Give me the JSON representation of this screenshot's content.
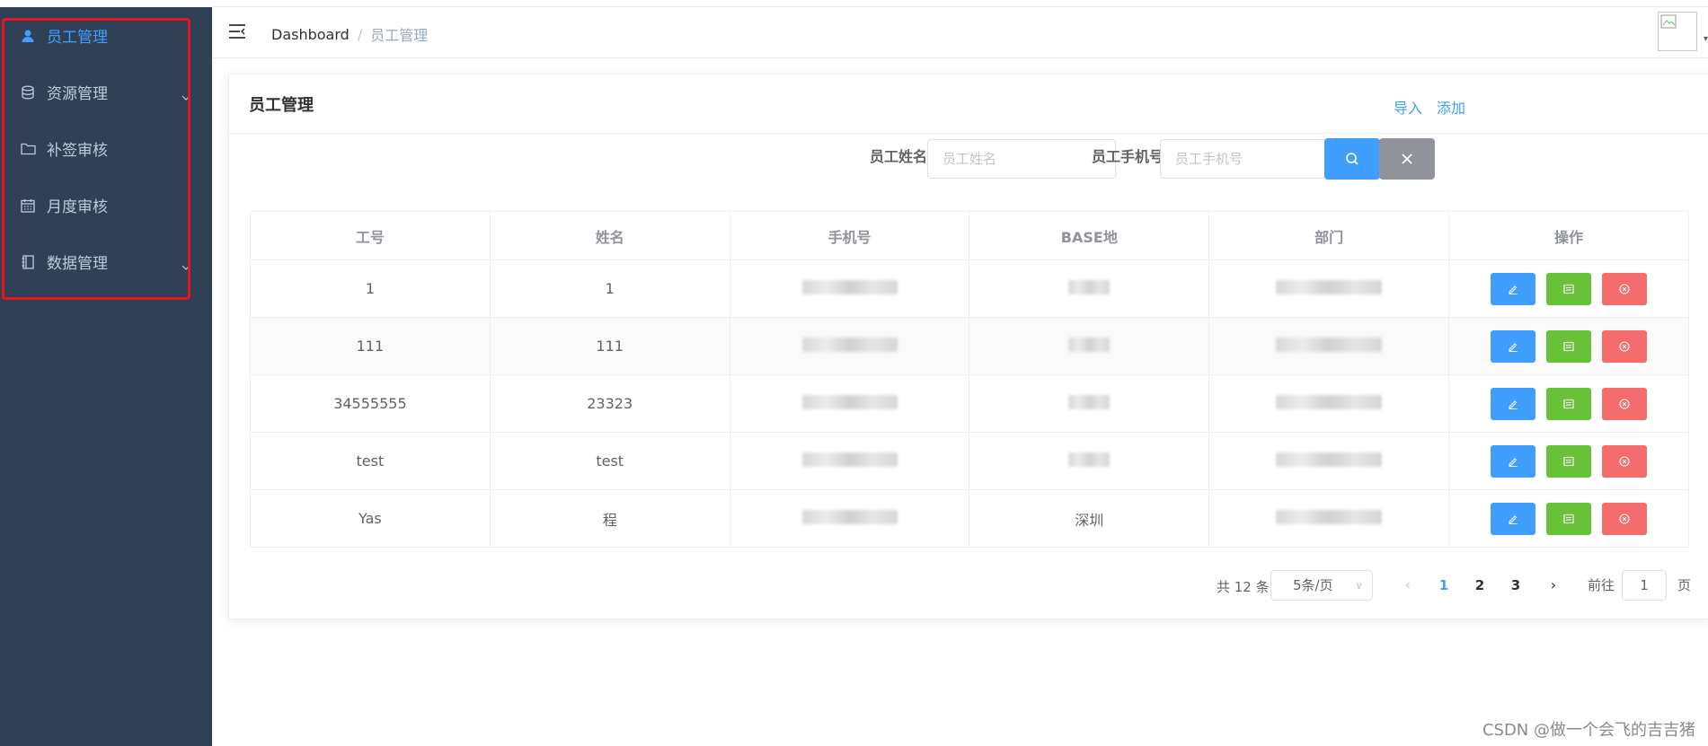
{
  "sidebar": {
    "items": [
      {
        "label": "员工管理",
        "icon": "user-icon",
        "active": true
      },
      {
        "label": "资源管理",
        "icon": "database-icon",
        "has_submenu": true
      },
      {
        "label": "补签审核",
        "icon": "folder-icon"
      },
      {
        "label": "月度审核",
        "icon": "calendar-icon"
      },
      {
        "label": "数据管理",
        "icon": "notebook-icon",
        "has_submenu": true
      }
    ]
  },
  "navbar": {
    "breadcrumb": [
      "Dashboard",
      "/",
      "员工管理"
    ]
  },
  "card": {
    "title": "员工管理",
    "import_label": "导入",
    "add_label": "添加"
  },
  "search": {
    "name_label": "员工姓名",
    "name_placeholder": "员工姓名",
    "phone_label": "员工手机号",
    "phone_placeholder": "员工手机号"
  },
  "table": {
    "columns": [
      "工号",
      "姓名",
      "手机号",
      "BASE地",
      "部门",
      "操作"
    ],
    "rows": [
      {
        "id": "1",
        "name": "1",
        "phone": "",
        "base": "",
        "dept": ""
      },
      {
        "id": "111",
        "name": "111",
        "phone": "",
        "base": "",
        "dept": ""
      },
      {
        "id": "34555555",
        "name": "23323",
        "phone": "",
        "base": "",
        "dept": ""
      },
      {
        "id": "test",
        "name": "test",
        "phone": "",
        "base": "",
        "dept": ""
      },
      {
        "id": "Yas",
        "name": "程",
        "phone": "",
        "base": "深圳",
        "dept": ""
      }
    ]
  },
  "pagination": {
    "total_text": "共 12 条",
    "page_size": "5条/页",
    "pages": [
      "1",
      "2",
      "3"
    ],
    "current_page": "1",
    "goto_prefix": "前往",
    "goto_value": "1",
    "goto_suffix": "页"
  },
  "watermark": "CSDN @做一个会飞的吉吉猪",
  "colors": {
    "sidebar_bg": "#304156",
    "primary": "#409eff",
    "success": "#67c23a",
    "danger": "#f56c6c",
    "info": "#909399",
    "highlight_border": "#e8141e"
  }
}
